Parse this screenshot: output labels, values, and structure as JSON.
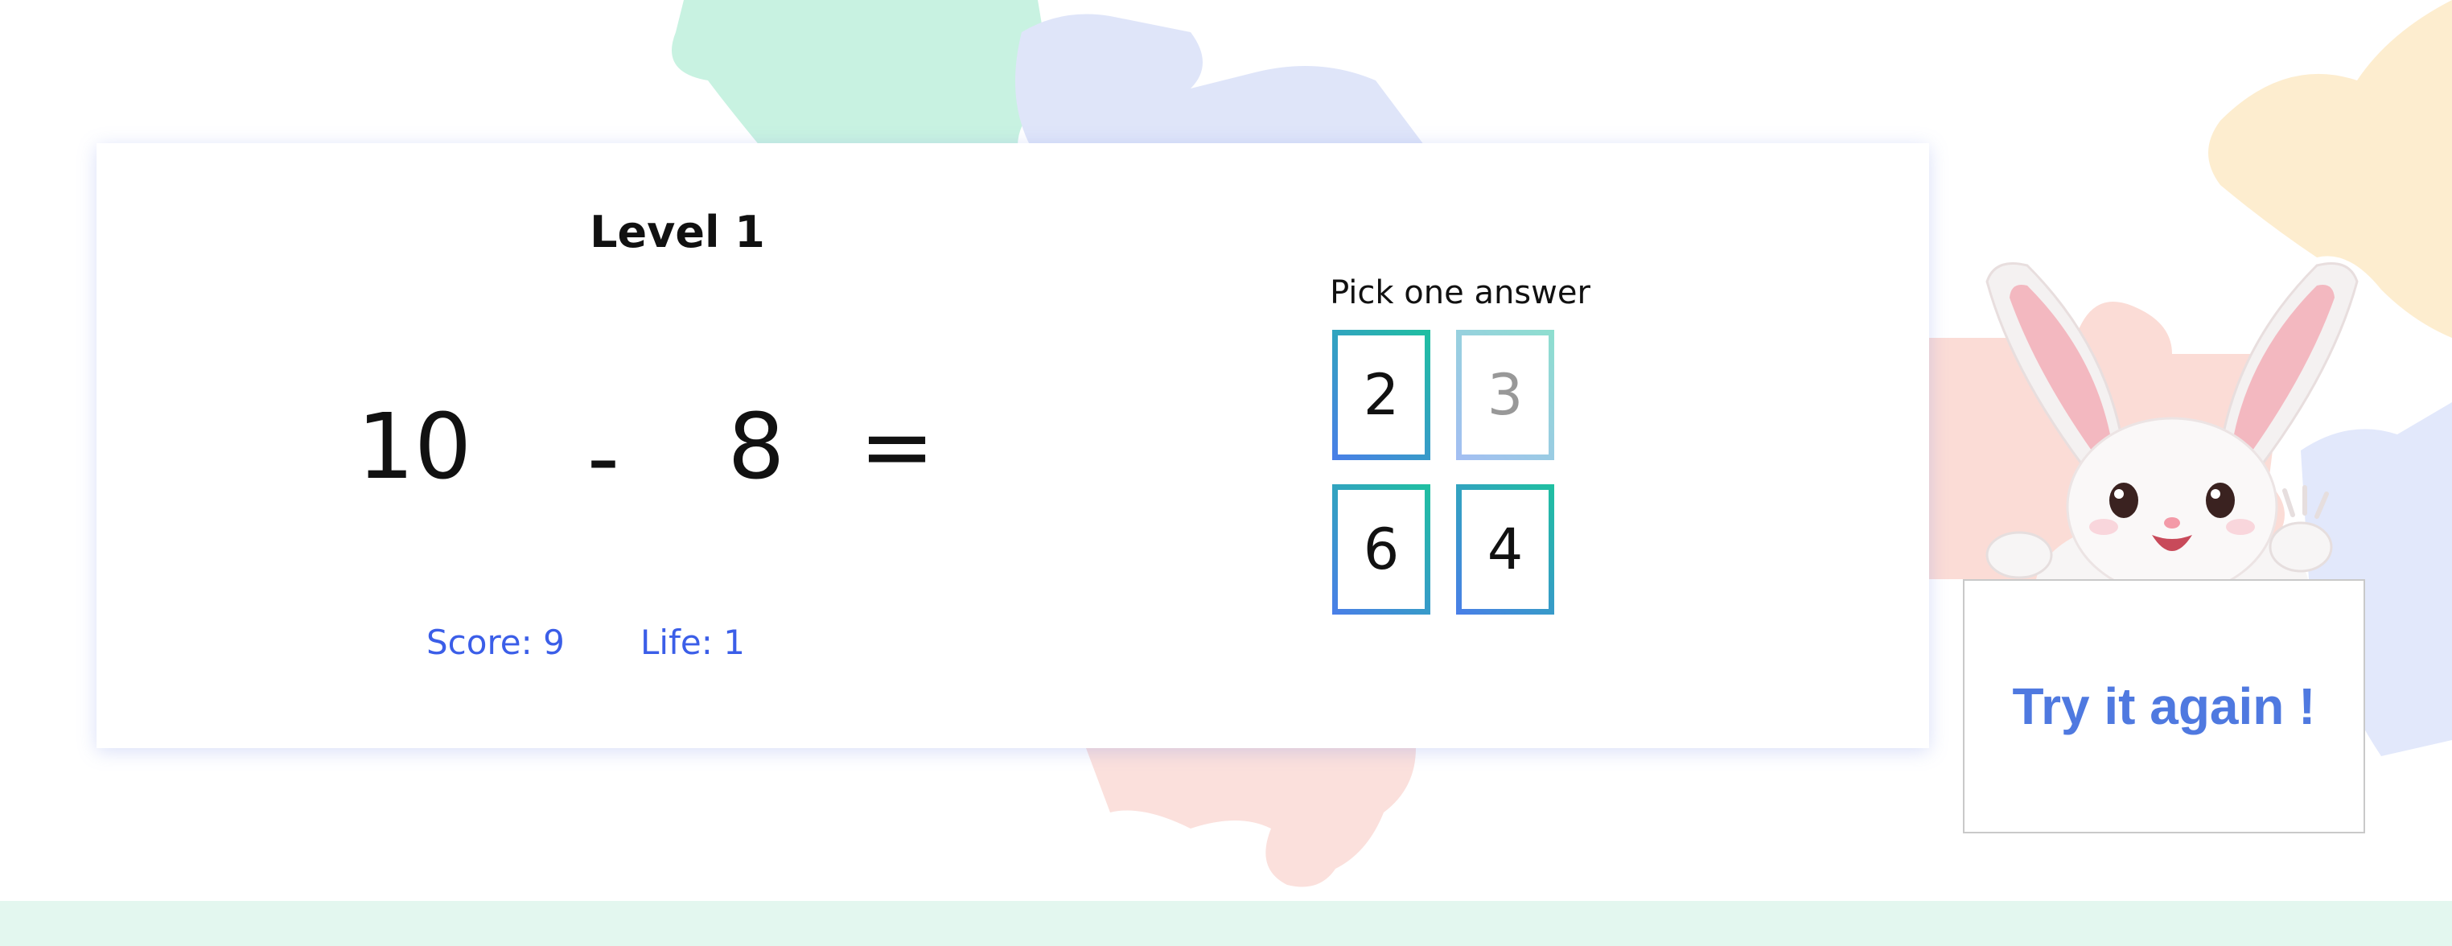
{
  "game": {
    "level_title": "Level 1",
    "equation": {
      "operand_a": "10",
      "operator": "-",
      "operand_b": "8",
      "equals": "="
    },
    "score_label": "Score: 9",
    "life_label": "Life: 1"
  },
  "answers": {
    "prompt": "Pick one answer",
    "options": [
      {
        "value": "2",
        "state": "active"
      },
      {
        "value": "3",
        "state": "faded"
      },
      {
        "value": "6",
        "state": "active"
      },
      {
        "value": "4",
        "state": "active"
      }
    ]
  },
  "feedback": {
    "retry_label": "Try it again !"
  },
  "colors": {
    "accent_blue": "#3b5ee8",
    "retry_blue": "#4f79e0",
    "option_gradient_start": "#4a7ee8",
    "option_gradient_end": "#1fc0a0",
    "footer_mint": "#e3f7ef"
  },
  "icons": {
    "mascot": "bunny-mascot-icon",
    "background": "puzzle-pieces"
  }
}
